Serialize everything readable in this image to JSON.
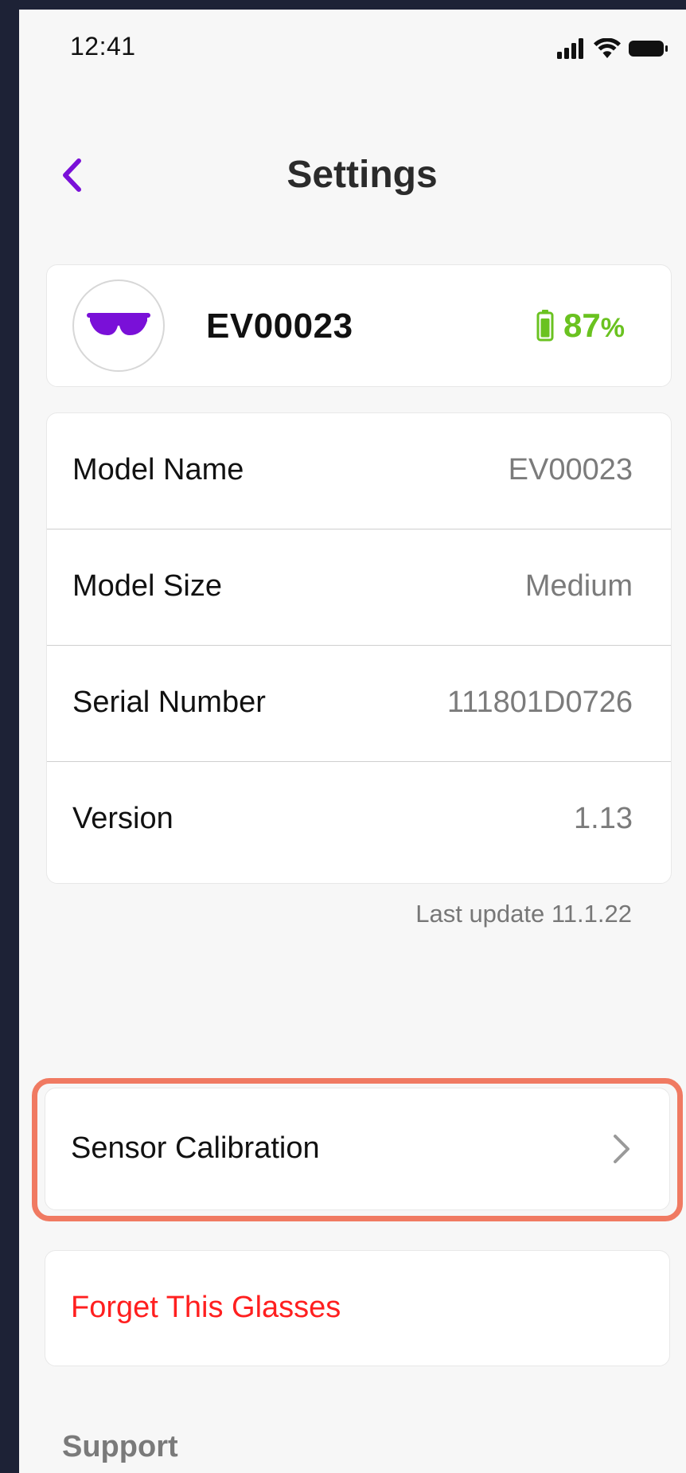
{
  "status_bar": {
    "time": "12:41"
  },
  "nav": {
    "title": "Settings",
    "back_icon": "chevron-left-icon"
  },
  "device": {
    "name": "EV00023",
    "battery_percent": "87",
    "battery_unit": "%",
    "battery_level": 0.87,
    "avatar_icon": "sunglasses-icon"
  },
  "info": {
    "rows": [
      {
        "label": "Model Name",
        "value": "EV00023"
      },
      {
        "label": "Model Size",
        "value": "Medium"
      },
      {
        "label": "Serial Number",
        "value": "111801D0726"
      },
      {
        "label": "Version",
        "value": "1.13"
      }
    ],
    "last_update": "Last update 11.1.22"
  },
  "actions": {
    "sensor_calibration": "Sensor Calibration",
    "forget_glasses": "Forget This Glasses"
  },
  "support": {
    "heading": "Support"
  },
  "colors": {
    "accent": "#7a10d8",
    "battery_green": "#6ac220",
    "danger": "#ff1f1f",
    "highlight": "#f07a62",
    "background": "#f7f7f7"
  }
}
